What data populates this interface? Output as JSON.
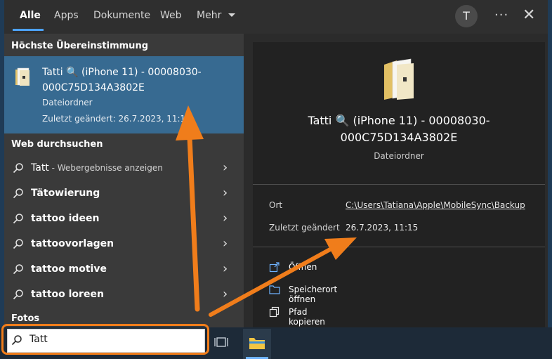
{
  "tabs": [
    {
      "label": "Alle",
      "active": true
    },
    {
      "label": "Apps"
    },
    {
      "label": "Dokumente"
    },
    {
      "label": "Web"
    },
    {
      "label": "Mehr"
    }
  ],
  "header": {
    "avatar_initial": "T",
    "more_options": "···",
    "close": "✕"
  },
  "best_match": {
    "section_title": "Höchste Übereinstimmung",
    "title_line1": "Tatti 🔍 (iPhone 11) - 00008030-",
    "title_line2": "000C75D134A3802E",
    "type": "Dateiordner",
    "modified": "Zuletzt geändert: 26.7.2023, 11:15"
  },
  "web_search": {
    "section_title": "Web durchsuchen",
    "first_item": {
      "term": "Tatt",
      "hint": " - Webergebnisse anzeigen"
    },
    "items": [
      {
        "label": "Tätowierung"
      },
      {
        "label": "tattoo ideen"
      },
      {
        "label": "tattoovorlagen"
      },
      {
        "label": "tattoo motive"
      },
      {
        "label": "tattoo loreen"
      }
    ]
  },
  "photos": {
    "section_title": "Fotos"
  },
  "detail": {
    "title_line1": "Tatti 🔍 (iPhone 11) - 00008030-",
    "title_line2": "000C75D134A3802E",
    "type": "Dateiordner",
    "location_label": "Ort",
    "location_value": "C:\\Users\\Tatiana\\Apple\\MobileSync\\Backup",
    "modified_label": "Zuletzt geändert",
    "modified_value": "26.7.2023, 11:15",
    "actions": [
      {
        "label": "Öffnen",
        "icon": "open-icon"
      },
      {
        "label": "Speicherort öffnen",
        "icon": "folder-icon"
      },
      {
        "label": "Pfad kopieren",
        "icon": "copy-icon"
      }
    ]
  },
  "search": {
    "value": "Tatt"
  },
  "colors": {
    "accent": "#4da3ff",
    "selected": "#376a91",
    "annotation": "#f07d1b"
  }
}
